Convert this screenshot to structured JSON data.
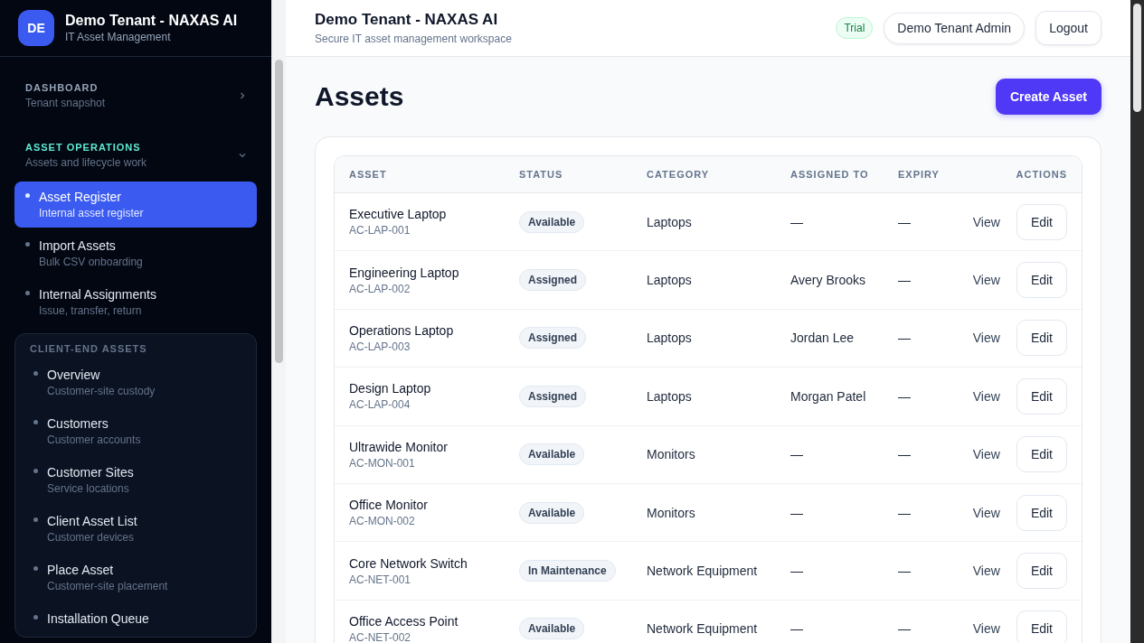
{
  "sidebar": {
    "brand": {
      "initials": "DE",
      "title": "Demo Tenant - NAXAS AI",
      "subtitle": "IT Asset Management"
    },
    "sections": [
      {
        "title": "DASHBOARD",
        "subtitle": "Tenant snapshot",
        "expanded": false
      },
      {
        "title": "ASSET OPERATIONS",
        "subtitle": "Assets and lifecycle work",
        "expanded": true,
        "items": [
          {
            "label": "Asset Register",
            "caption": "Internal asset register",
            "selected": true
          },
          {
            "label": "Import Assets",
            "caption": "Bulk CSV onboarding",
            "selected": false
          },
          {
            "label": "Internal Assignments",
            "caption": "Issue, transfer, return",
            "selected": false
          }
        ]
      }
    ],
    "group": {
      "title": "CLIENT-END ASSETS",
      "items": [
        {
          "label": "Overview",
          "caption": "Customer-site custody",
          "selected": false
        },
        {
          "label": "Customers",
          "caption": "Customer accounts",
          "selected": false
        },
        {
          "label": "Customer Sites",
          "caption": "Service locations",
          "selected": false
        },
        {
          "label": "Client Asset List",
          "caption": "Customer devices",
          "selected": false
        },
        {
          "label": "Place Asset",
          "caption": "Customer-site placement",
          "selected": false
        },
        {
          "label": "Installation Queue",
          "selected": false
        }
      ]
    }
  },
  "header": {
    "title": "Demo Tenant - NAXAS AI",
    "subtitle": "Secure IT asset management workspace",
    "badge": "Trial",
    "user": "Demo Tenant Admin",
    "logout": "Logout"
  },
  "page": {
    "title": "Assets",
    "create_button": "Create Asset"
  },
  "table": {
    "columns": [
      "ASSET",
      "STATUS",
      "CATEGORY",
      "ASSIGNED TO",
      "EXPIRY",
      "ACTIONS"
    ],
    "rows": [
      {
        "name": "Executive Laptop",
        "code": "AC-LAP-001",
        "status": "Available",
        "category": "Laptops",
        "assigned": "—",
        "expiry": "—",
        "view": "View",
        "edit": "Edit"
      },
      {
        "name": "Engineering Laptop",
        "code": "AC-LAP-002",
        "status": "Assigned",
        "category": "Laptops",
        "assigned": "Avery Brooks",
        "expiry": "—",
        "view": "View",
        "edit": "Edit"
      },
      {
        "name": "Operations Laptop",
        "code": "AC-LAP-003",
        "status": "Assigned",
        "category": "Laptops",
        "assigned": "Jordan Lee",
        "expiry": "—",
        "view": "View",
        "edit": "Edit"
      },
      {
        "name": "Design Laptop",
        "code": "AC-LAP-004",
        "status": "Assigned",
        "category": "Laptops",
        "assigned": "Morgan Patel",
        "expiry": "—",
        "view": "View",
        "edit": "Edit"
      },
      {
        "name": "Ultrawide Monitor",
        "code": "AC-MON-001",
        "status": "Available",
        "category": "Monitors",
        "assigned": "—",
        "expiry": "—",
        "view": "View",
        "edit": "Edit"
      },
      {
        "name": "Office Monitor",
        "code": "AC-MON-002",
        "status": "Available",
        "category": "Monitors",
        "assigned": "—",
        "expiry": "—",
        "view": "View",
        "edit": "Edit"
      },
      {
        "name": "Core Network Switch",
        "code": "AC-NET-001",
        "status": "In Maintenance",
        "category": "Network Equipment",
        "assigned": "—",
        "expiry": "—",
        "view": "View",
        "edit": "Edit"
      },
      {
        "name": "Office Access Point",
        "code": "AC-NET-002",
        "status": "Available",
        "category": "Network Equipment",
        "assigned": "—",
        "expiry": "—",
        "view": "View",
        "edit": "Edit"
      }
    ]
  }
}
